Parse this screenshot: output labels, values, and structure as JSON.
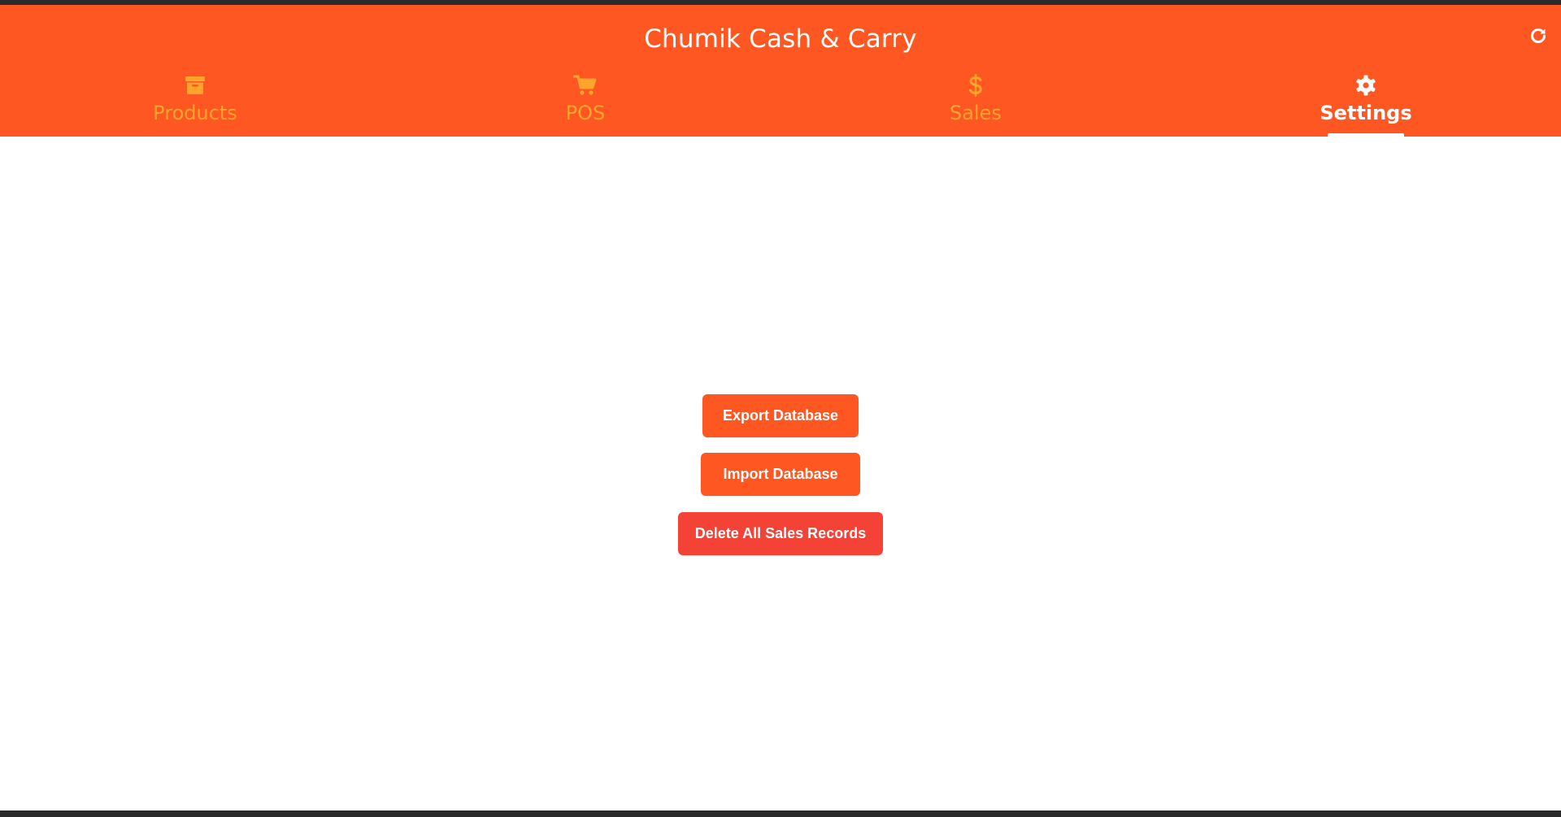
{
  "app": {
    "title": "Chumik Cash & Carry",
    "refresh_icon": "refresh-icon"
  },
  "colors": {
    "header": "#ff5722",
    "inactive_tab": "#ffa42d",
    "active_tab": "#ffffff",
    "primary_button": "#ff5722",
    "danger_button": "#f44336"
  },
  "tabs": [
    {
      "label": "Products",
      "icon": "archive-box-icon",
      "active": false
    },
    {
      "label": "POS",
      "icon": "shopping-cart-icon",
      "active": false
    },
    {
      "label": "Sales",
      "icon": "dollar-icon",
      "active": false
    },
    {
      "label": "Settings",
      "icon": "gear-icon",
      "active": true
    }
  ],
  "settings": {
    "export_label": "Export Database",
    "import_label": "Import Database",
    "delete_label": "Delete All Sales Records"
  }
}
